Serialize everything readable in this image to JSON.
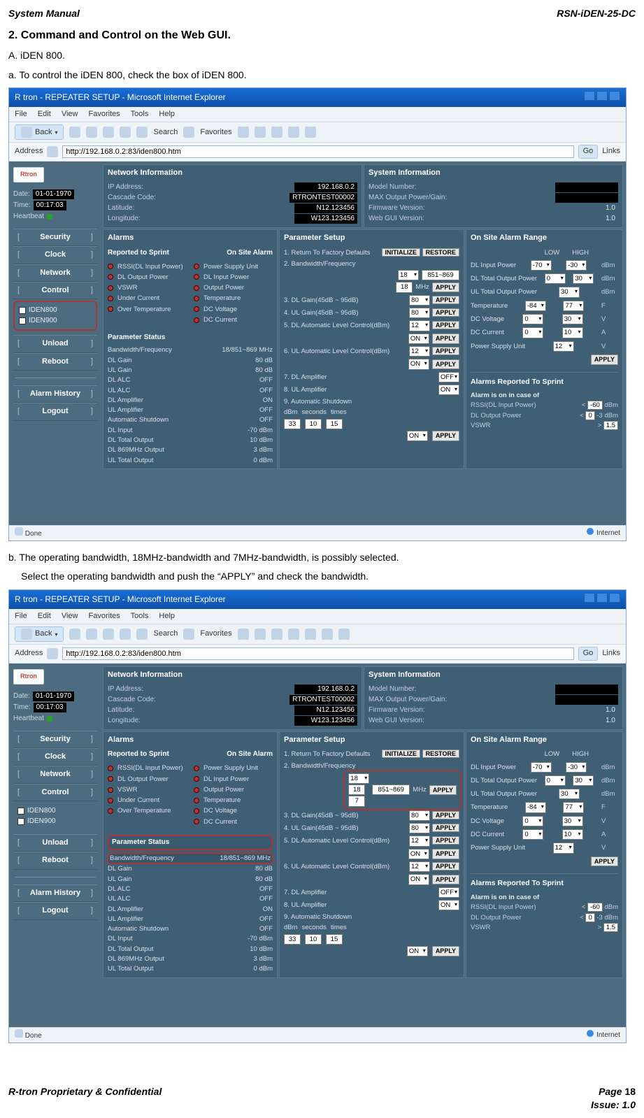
{
  "header": {
    "left": "System Manual",
    "right": "RSN-iDEN-25-DC"
  },
  "heading": "2. Command and Control on the Web GUI.",
  "paraA": "A. iDEN 800.",
  "paraA1": "a. To control the iDEN 800, check the box of iDEN 800.",
  "paraB": "b. The operating bandwidth, 18MHz-bandwidth and 7MHz-bandwidth, is possibly selected.",
  "paraB2": "Select the operating bandwidth and push the “APPLY” and check the bandwidth.",
  "browser": {
    "title": "R tron - REPEATER SETUP - Microsoft Internet Explorer",
    "menu": [
      "File",
      "Edit",
      "View",
      "Favorites",
      "Tools",
      "Help"
    ],
    "back": "Back",
    "search": "Search",
    "favorites": "Favorites",
    "address_label": "Address",
    "url": "http://192.168.0.2:83/iden800.htm",
    "go": "Go",
    "links": "Links",
    "status": "Done",
    "zone": "Internet"
  },
  "sidebar": {
    "logo": "Rtron",
    "date_label": "Date:",
    "date_value": "01-01-1970",
    "time_label": "Time:",
    "time_value": "00:17:03",
    "heartbeat_label": "Heartbeat",
    "items": [
      "Security",
      "Clock",
      "Network",
      "Control",
      "Unload",
      "Reboot",
      "Alarm History",
      "Logout"
    ],
    "checks": {
      "iden800": "IDEN800",
      "iden900": "IDEN900"
    }
  },
  "netinfo": {
    "title": "Network Information",
    "rows": [
      {
        "k": "IP Address:",
        "v": "192.168.0.2"
      },
      {
        "k": "Cascade Code:",
        "v": "RTRONTEST00002"
      },
      {
        "k": "Latitude:",
        "v": "N12.123456"
      },
      {
        "k": "Longitude:",
        "v": "W123.123456"
      }
    ]
  },
  "sysinfo": {
    "title": "System Information",
    "rows": [
      {
        "k": "Model Number:",
        "v": ""
      },
      {
        "k": "MAX Output Power/Gain:",
        "v": ""
      },
      {
        "k": "Firmware Version:",
        "v": "1.0"
      },
      {
        "k": "Web GUI Version:",
        "v": "1.0"
      }
    ]
  },
  "alarms": {
    "title": "Alarms",
    "subleft": "Reported to Sprint",
    "subright": "On Site Alarm",
    "left": [
      "RSSI(DL Input Power)",
      "DL Output Power",
      "VSWR",
      "Under Current",
      "Over Temperature"
    ],
    "right": [
      "Power Supply Unit",
      "DL Input Power",
      "Output Power",
      "Temperature",
      "DC Voltage",
      "DC Current"
    ],
    "pstitle": "Parameter Status",
    "pstatus": [
      {
        "k": "Bandwidth/Frequency",
        "v": "18/851~869 MHz"
      },
      {
        "k": "DL Gain",
        "v": "80 dB"
      },
      {
        "k": "UL Gain",
        "v": "80 dB"
      },
      {
        "k": "DL ALC",
        "v": "OFF"
      },
      {
        "k": "UL ALC",
        "v": "OFF"
      },
      {
        "k": "DL Amplifier",
        "v": "ON"
      },
      {
        "k": "UL Amplifier",
        "v": "OFF"
      },
      {
        "k": "Automatic Shutdown",
        "v": "OFF"
      },
      {
        "k": "DL Input",
        "v": "-70 dBm"
      },
      {
        "k": "DL Total Output",
        "v": "10 dBm"
      },
      {
        "k": "DL 869MHz Output",
        "v": "3 dBm"
      },
      {
        "k": "UL Total Output",
        "v": "0 dBm"
      }
    ]
  },
  "params": {
    "title": "Parameter Setup",
    "restore": "RESTORE",
    "init": "INITIALIZE",
    "items": {
      "i1": "1. Return To Factory Defaults",
      "i2": "2. Bandwidth/Frequency",
      "bw1_18": "18",
      "bw1_7": "7",
      "bwrange": "851~869",
      "mhz": "MHz",
      "apply": "APPLY",
      "i3": "3. DL Gain(45dB ~ 95dB)",
      "i3v": "80",
      "i4": "4. UL Gain(45dB ~ 95dB)",
      "i4v": "80",
      "i5": "5. DL Automatic Level Control(dBm)",
      "i5v": "12",
      "on": "ON",
      "off": "OFF",
      "i6": "6. UL Automatic Level Control(dBm)",
      "i6v": "12",
      "i7": "7. DL Amplifier",
      "i8": "8. UL Amplifier",
      "i9": "9. Automatic Shutdown",
      "asd_dbm": "dBm",
      "asd_sec": "seconds",
      "asd_times": "times",
      "asd_v1": "33",
      "asd_v2": "10",
      "asd_v3": "15"
    }
  },
  "onsite": {
    "title": "On Site Alarm Range",
    "low": "LOW",
    "high": "HIGH",
    "rows": [
      {
        "name": "DL Input Power",
        "low": "-70",
        "high": "-30",
        "unit": "dBm"
      },
      {
        "name": "DL Total Output Power",
        "low": "0",
        "high": "30",
        "unit": "dBm"
      },
      {
        "name": "UL Total Output Power",
        "low": "",
        "high": "30",
        "unit": "dBm"
      },
      {
        "name": "Temperature",
        "low": "-84",
        "high": "77",
        "unit": "F"
      },
      {
        "name": "DC Voltage",
        "low": "0",
        "high": "30",
        "unit": "V"
      },
      {
        "name": "DC Current",
        "low": "0",
        "high": "10",
        "unit": "A"
      },
      {
        "name": "Power Supply Unit",
        "low": "",
        "high": "12",
        "unit": "V"
      }
    ],
    "apply": "APPLY",
    "rep_title": "Alarms Reported To Sprint",
    "rep_head": "Alarm is on in case of",
    "rep_rows": [
      {
        "k": "RSSI(DL Input Power)",
        "op": "<",
        "v": "-60",
        "u": "dBm"
      },
      {
        "k": "DL Output Power",
        "op": "<",
        "v": "0",
        "u": "-3 dBm"
      },
      {
        "k": "VSWR",
        "op": ">",
        "v": "1.5",
        "u": ""
      }
    ]
  },
  "footer": {
    "left": "R-tron Proprietary & Confidential",
    "page_label": "Page ",
    "page_no": "18",
    "issue": "Issue: 1.0"
  }
}
